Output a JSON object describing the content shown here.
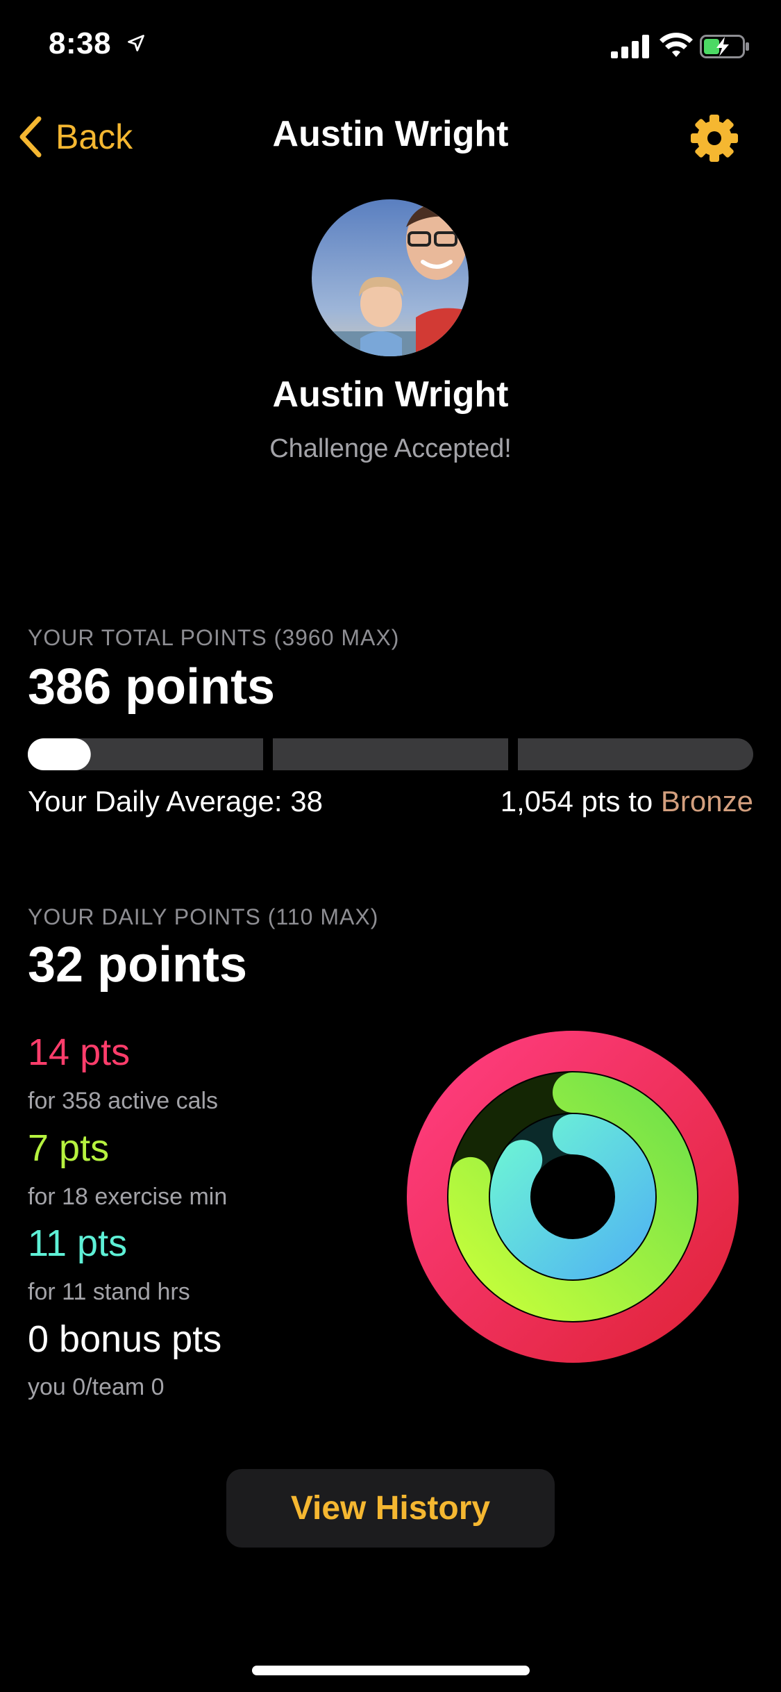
{
  "status_bar": {
    "time": "8:38"
  },
  "nav": {
    "back_label": "Back",
    "title": "Austin Wright"
  },
  "profile": {
    "name": "Austin Wright",
    "status": "Challenge Accepted!"
  },
  "total": {
    "label": "YOUR TOTAL POINTS (3960 MAX)",
    "points": "386 points",
    "daily_average": "Your Daily Average: 38",
    "to_next_prefix": "1,054 pts to ",
    "next_tier": "Bronze",
    "progress_fraction": 0.0975
  },
  "daily": {
    "label": "YOUR DAILY POINTS (110 MAX)",
    "points": "32 points",
    "items": [
      {
        "pts": "14 pts",
        "detail": "for 358 active cals",
        "color": "#ff3d6b"
      },
      {
        "pts": "7 pts",
        "detail": "for 18 exercise min",
        "color": "#b6f23f"
      },
      {
        "pts": "11 pts",
        "detail": "for 11 stand hrs",
        "color": "#5ef0d6"
      },
      {
        "pts": "0 bonus pts",
        "detail": "you 0/team 0",
        "color": "#ffffff"
      }
    ],
    "rings": {
      "move_fraction": 1.17,
      "exercise_fraction": 0.78,
      "stand_fraction": 0.85
    }
  },
  "colors": {
    "accent": "#f5b731",
    "move": "#e8385a",
    "exercise": "#a6f03a",
    "stand": "#5fd0e6"
  },
  "button": {
    "history_label": "View History"
  }
}
